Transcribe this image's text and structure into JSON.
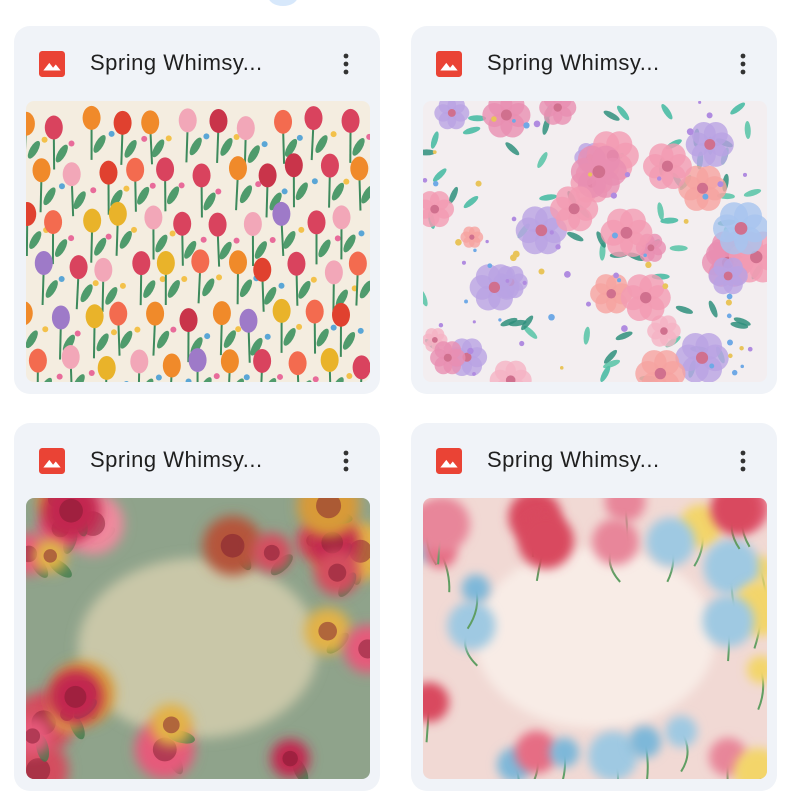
{
  "files": [
    {
      "title": "Spring Whimsy...",
      "icon": "image-file-icon",
      "menu_icon": "more-vert-icon",
      "thumbnail": "watercolor-tulip-pattern"
    },
    {
      "title": "Spring Whimsy...",
      "icon": "image-file-icon",
      "menu_icon": "more-vert-icon",
      "thumbnail": "pastel-floral-pattern"
    },
    {
      "title": "Spring Whimsy...",
      "icon": "image-file-icon",
      "menu_icon": "more-vert-icon",
      "thumbnail": "painted-rose-frame"
    },
    {
      "title": "Spring Whimsy...",
      "icon": "image-file-icon",
      "menu_icon": "more-vert-icon",
      "thumbnail": "pink-floral-frame"
    }
  ],
  "colors": {
    "card_bg": "#f0f3f8",
    "icon_red": "#ea4335",
    "title_text": "#1f1f1f"
  }
}
